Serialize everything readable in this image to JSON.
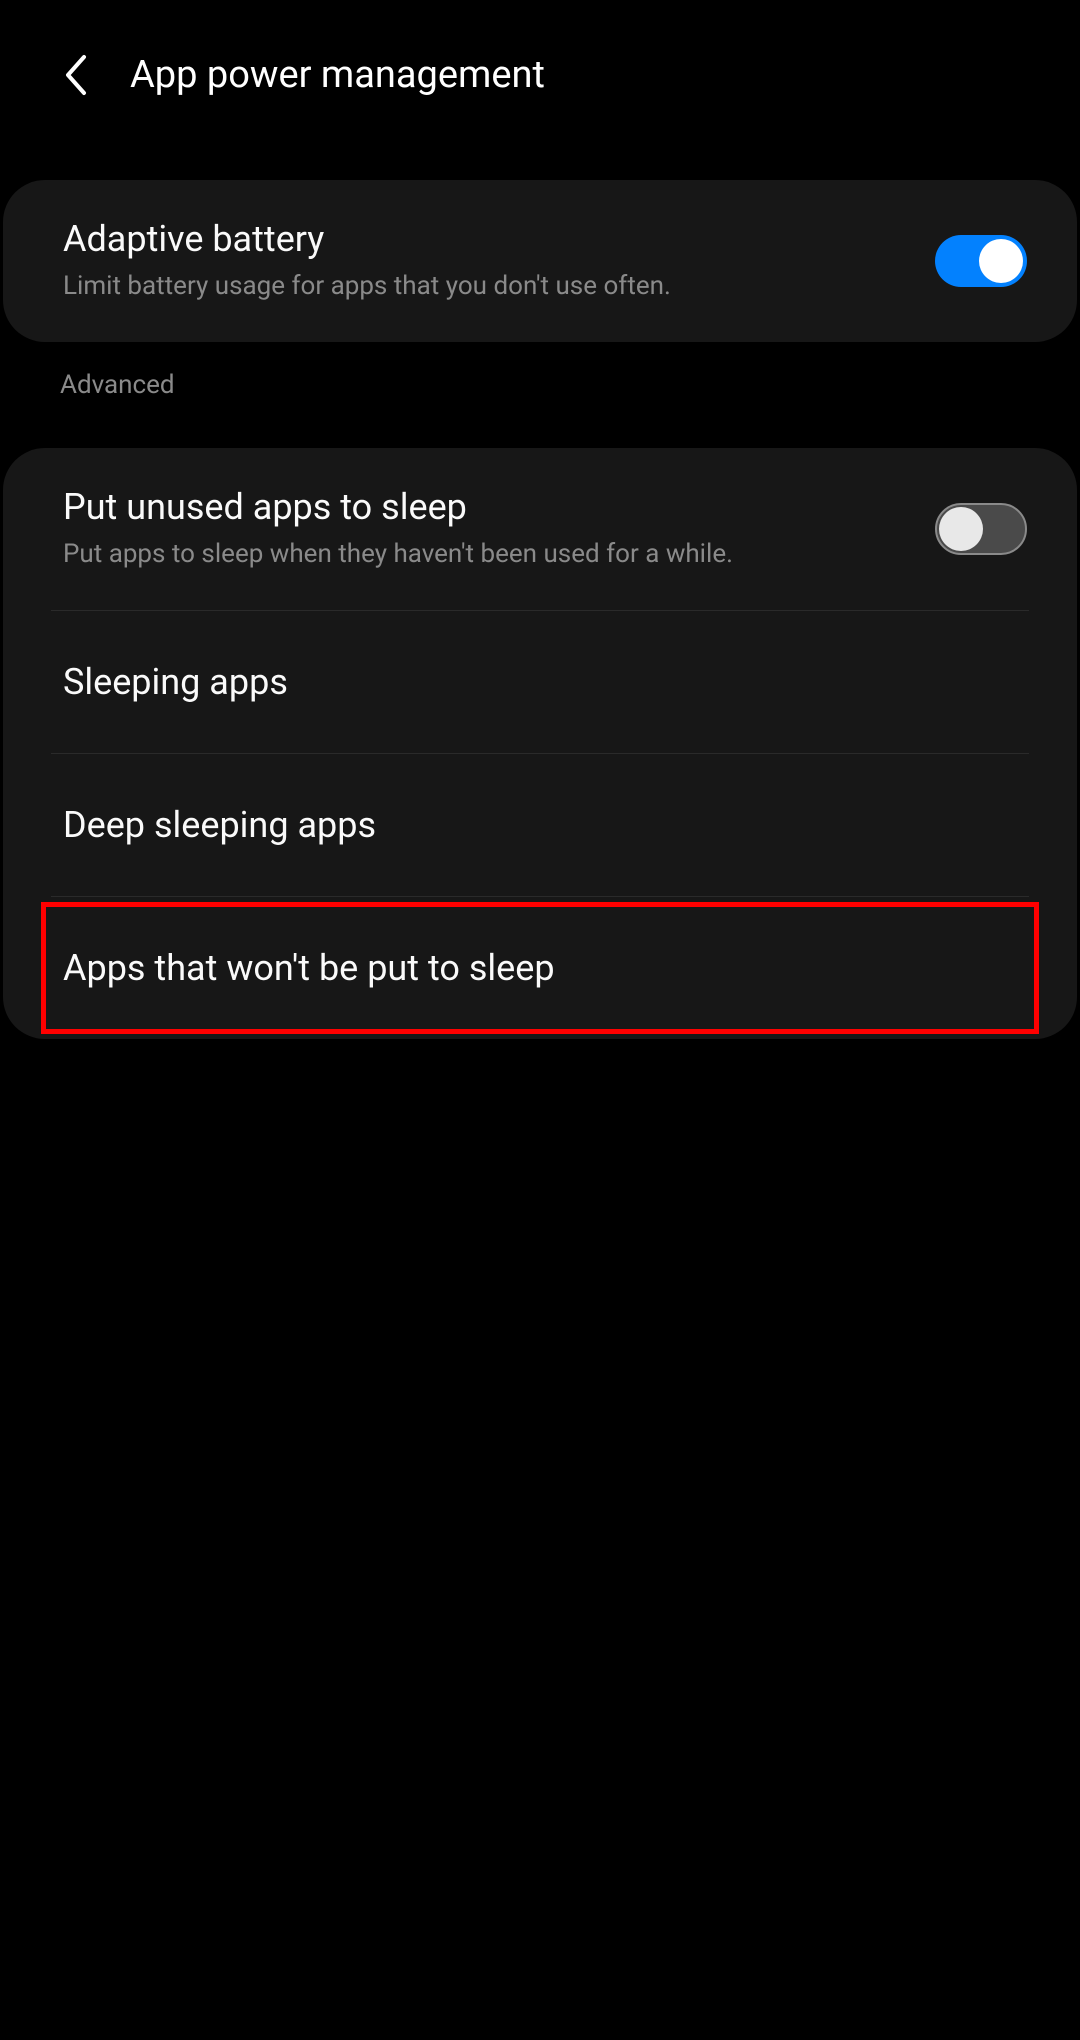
{
  "header": {
    "title": "App power management"
  },
  "card1": {
    "adaptive_battery": {
      "title": "Adaptive battery",
      "subtitle": "Limit battery usage for apps that you don't use often.",
      "enabled": true
    }
  },
  "section_label": "Advanced",
  "card2": {
    "put_unused_to_sleep": {
      "title": "Put unused apps to sleep",
      "subtitle": "Put apps to sleep when they haven't been used for a while.",
      "enabled": false
    },
    "sleeping_apps": {
      "title": "Sleeping apps"
    },
    "deep_sleeping_apps": {
      "title": "Deep sleeping apps"
    },
    "apps_not_sleep": {
      "title": "Apps that won't be put to sleep"
    }
  },
  "colors": {
    "toggle_on": "#0381fe",
    "highlight": "#ff0000"
  }
}
